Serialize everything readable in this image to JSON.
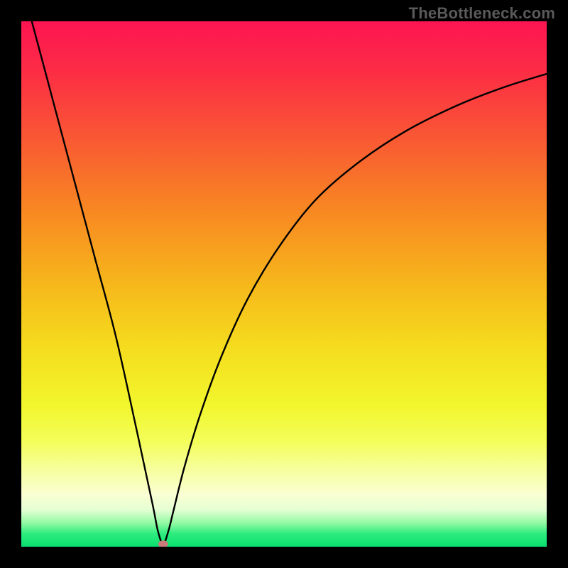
{
  "watermark": "TheBottleneck.com",
  "chart_data": {
    "type": "line",
    "title": "",
    "xlabel": "",
    "ylabel": "",
    "xlim": [
      0,
      100
    ],
    "ylim": [
      0,
      100
    ],
    "x_min_curve": 27,
    "series": [
      {
        "name": "curve",
        "points": [
          {
            "x": 0,
            "y": 107
          },
          {
            "x": 2,
            "y": 100
          },
          {
            "x": 6,
            "y": 85
          },
          {
            "x": 10,
            "y": 70
          },
          {
            "x": 14,
            "y": 55
          },
          {
            "x": 18,
            "y": 40
          },
          {
            "x": 22,
            "y": 22
          },
          {
            "x": 25,
            "y": 8
          },
          {
            "x": 26,
            "y": 3
          },
          {
            "x": 27,
            "y": 0.5
          },
          {
            "x": 28,
            "y": 3
          },
          {
            "x": 29,
            "y": 7
          },
          {
            "x": 31,
            "y": 15
          },
          {
            "x": 34,
            "y": 25
          },
          {
            "x": 38,
            "y": 36
          },
          {
            "x": 43,
            "y": 47
          },
          {
            "x": 49,
            "y": 57
          },
          {
            "x": 56,
            "y": 66
          },
          {
            "x": 64,
            "y": 73
          },
          {
            "x": 73,
            "y": 79
          },
          {
            "x": 83,
            "y": 84
          },
          {
            "x": 92,
            "y": 87.5
          },
          {
            "x": 100,
            "y": 90
          }
        ]
      }
    ],
    "marker": {
      "x": 27,
      "y": 0.5,
      "color": "#c97a7a"
    },
    "gradient_stops": [
      {
        "offset": 0,
        "color": "#fd1452"
      },
      {
        "offset": 0.1,
        "color": "#fc2e44"
      },
      {
        "offset": 0.22,
        "color": "#f95734"
      },
      {
        "offset": 0.35,
        "color": "#f88423"
      },
      {
        "offset": 0.5,
        "color": "#f6b71b"
      },
      {
        "offset": 0.62,
        "color": "#f5dc1e"
      },
      {
        "offset": 0.73,
        "color": "#f2f62c"
      },
      {
        "offset": 0.8,
        "color": "#f3fe5a"
      },
      {
        "offset": 0.85,
        "color": "#f6ff9a"
      },
      {
        "offset": 0.9,
        "color": "#faffd2"
      },
      {
        "offset": 0.93,
        "color": "#e4ffd3"
      },
      {
        "offset": 0.956,
        "color": "#8ef9a1"
      },
      {
        "offset": 0.975,
        "color": "#2eec7e"
      },
      {
        "offset": 1.0,
        "color": "#09e26f"
      }
    ]
  }
}
